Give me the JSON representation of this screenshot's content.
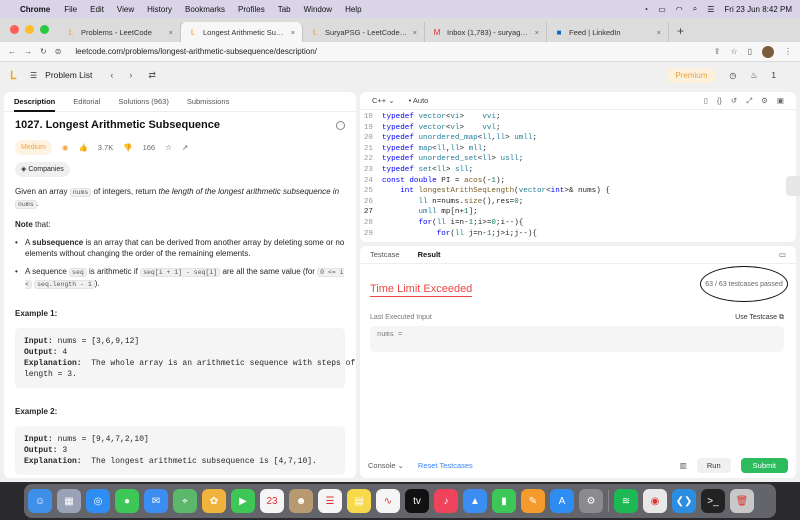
{
  "menubar": {
    "app": "Chrome",
    "items": [
      "File",
      "Edit",
      "View",
      "History",
      "Bookmarks",
      "Profiles",
      "Tab",
      "Window",
      "Help"
    ],
    "clock": "Fri 23 Jun  8:42 PM"
  },
  "tabs": [
    {
      "title": "Problems - LeetCode",
      "icon": "leetcode-icon"
    },
    {
      "title": "Longest Arithmetic Subseque…",
      "icon": "leetcode-icon"
    },
    {
      "title": "SuryaPSG - LeetCode Profile",
      "icon": "leetcode-icon"
    },
    {
      "title": "Inbox (1,783) - suryaganesh.p…",
      "icon": "gmail-icon"
    },
    {
      "title": "Feed | LinkedIn",
      "icon": "linkedin-icon"
    }
  ],
  "address": {
    "url": "leetcode.com/problems/longest-arithmetic-subsequence/description/"
  },
  "lcnav": {
    "problem_list": "Problem List",
    "premium": "Premium",
    "streak": "1"
  },
  "left_tabs": [
    "Description",
    "Editorial",
    "Solutions (963)",
    "Submissions"
  ],
  "problem": {
    "title": "1027. Longest Arithmetic Subsequence",
    "difficulty": "Medium",
    "likes": "3.7K",
    "dislikes": "166",
    "companies": "Companies",
    "desc_a": "Given an array ",
    "desc_code": "nums",
    "desc_b": " of integers, return ",
    "desc_i": "the length of the longest arithmetic subsequence in",
    "desc_code2": "nums",
    "desc_end": ".",
    "note": "Note",
    "note_rest": " that:",
    "b1_bold": "subsequence",
    "b1_a": "A ",
    "b1_b": " is an array that can be derived from another array by deleting some or no elements without changing the order of the remaining elements.",
    "b2_a": "A sequence ",
    "b2_code1": "seq",
    "b2_b": " is arithmetic if ",
    "b2_code2": "seq[i + 1] - seq[i]",
    "b2_c": " are all the same value (for ",
    "b2_code3": "0 <= i <",
    "b2_code4": "seq.length - 1",
    "b2_d": ").",
    "ex1_title": "Example 1:",
    "ex1_input_label": "Input:",
    "ex1_input": " nums = [3,6,9,12]",
    "ex1_output_label": "Output:",
    "ex1_output": " 4",
    "ex1_expl_label": "Explanation:",
    "ex1_expl": "  The whole array is an arithmetic sequence with steps of\nlength = 3.",
    "ex2_title": "Example 2:",
    "ex2_input_label": "Input:",
    "ex2_input": " nums = [9,4,7,2,10]",
    "ex2_output_label": "Output:",
    "ex2_output": " 3",
    "ex2_expl_label": "Explanation:",
    "ex2_expl": "  The longest arithmetic subsequence is [4,7,10]."
  },
  "editor": {
    "language": "C++",
    "mode": "Auto",
    "lines": [
      {
        "n": "18",
        "code": "typedef vector<vi>    vvi;"
      },
      {
        "n": "19",
        "code": "typedef vector<vl>    vvl;"
      },
      {
        "n": "20",
        "code": "typedef unordered_map<ll,ll> umll;"
      },
      {
        "n": "21",
        "code": "typedef map<ll,ll> mll;"
      },
      {
        "n": "22",
        "code": "typedef unordered_set<ll> usll;"
      },
      {
        "n": "23",
        "code": "typedef set<ll> sll;"
      },
      {
        "n": "24",
        "code": "const double PI = acos(-1);"
      },
      {
        "n": "25",
        "code": "    int longestArithSeqLength(vector<int>& nums) {"
      },
      {
        "n": "26",
        "code": "        ll n=nums.size(),res=0;"
      },
      {
        "n": "27",
        "code": "        umll mp[n+1];"
      },
      {
        "n": "28",
        "code": "        for(ll i=n-1;i>=0;i--){"
      },
      {
        "n": "29",
        "code": "            for(ll j=n-1;j>i;j--){"
      }
    ]
  },
  "result": {
    "tabs": [
      "Testcase",
      "Result"
    ],
    "status": "Time Limit Exceeded",
    "passed": "63 / 63  testcases passed",
    "last_input_label": "Last Executed Input",
    "use_testcase": "Use Testcase",
    "nums_label": "nums ="
  },
  "footer": {
    "console": "Console",
    "reset": "Reset Testcases",
    "run": "Run",
    "submit": "Submit"
  },
  "dock": [
    {
      "name": "finder",
      "color": "#3d8fe8",
      "glyph": "☺"
    },
    {
      "name": "launchpad",
      "color": "#9aa3b5",
      "glyph": "▦"
    },
    {
      "name": "safari",
      "color": "#2f8cf0",
      "glyph": "◎"
    },
    {
      "name": "messages",
      "color": "#3cc756",
      "glyph": "●"
    },
    {
      "name": "mail",
      "color": "#3b8df2",
      "glyph": "✉"
    },
    {
      "name": "maps",
      "color": "#5bb86b",
      "glyph": "⌖"
    },
    {
      "name": "photos",
      "color": "#f2b33d",
      "glyph": "✿"
    },
    {
      "name": "facetime",
      "color": "#3cc756",
      "glyph": "▶"
    },
    {
      "name": "calendar",
      "color": "#f5f5f5",
      "glyph": "23"
    },
    {
      "name": "contacts",
      "color": "#b89a72",
      "glyph": "☻"
    },
    {
      "name": "reminders",
      "color": "#f5f5f5",
      "glyph": "☰"
    },
    {
      "name": "notes",
      "color": "#f7d94c",
      "glyph": "▤"
    },
    {
      "name": "freeform",
      "color": "#f5f5f5",
      "glyph": "∿"
    },
    {
      "name": "tv",
      "color": "#111111",
      "glyph": "tv"
    },
    {
      "name": "music",
      "color": "#f0435b",
      "glyph": "♪"
    },
    {
      "name": "keynote",
      "color": "#3b8df2",
      "glyph": "▲"
    },
    {
      "name": "numbers",
      "color": "#3cc756",
      "glyph": "▮"
    },
    {
      "name": "pages",
      "color": "#f59b2c",
      "glyph": "✎"
    },
    {
      "name": "appstore",
      "color": "#2f8cf0",
      "glyph": "A"
    },
    {
      "name": "settings",
      "color": "#8a8a8f",
      "glyph": "⚙"
    },
    {
      "name": "spotify",
      "color": "#1db954",
      "glyph": "≋"
    },
    {
      "name": "chrome",
      "color": "#e8e8e8",
      "glyph": "◉"
    },
    {
      "name": "vscode",
      "color": "#2b8de0",
      "glyph": "❮❯"
    },
    {
      "name": "terminal",
      "color": "#222222",
      "glyph": ">_"
    },
    {
      "name": "trash",
      "color": "#c8c8c8",
      "glyph": "🗑"
    }
  ],
  "colors": {
    "accent": "#f89f1b",
    "error": "#ef4743",
    "submit": "#2cbb5d",
    "link": "#3b82f6"
  }
}
